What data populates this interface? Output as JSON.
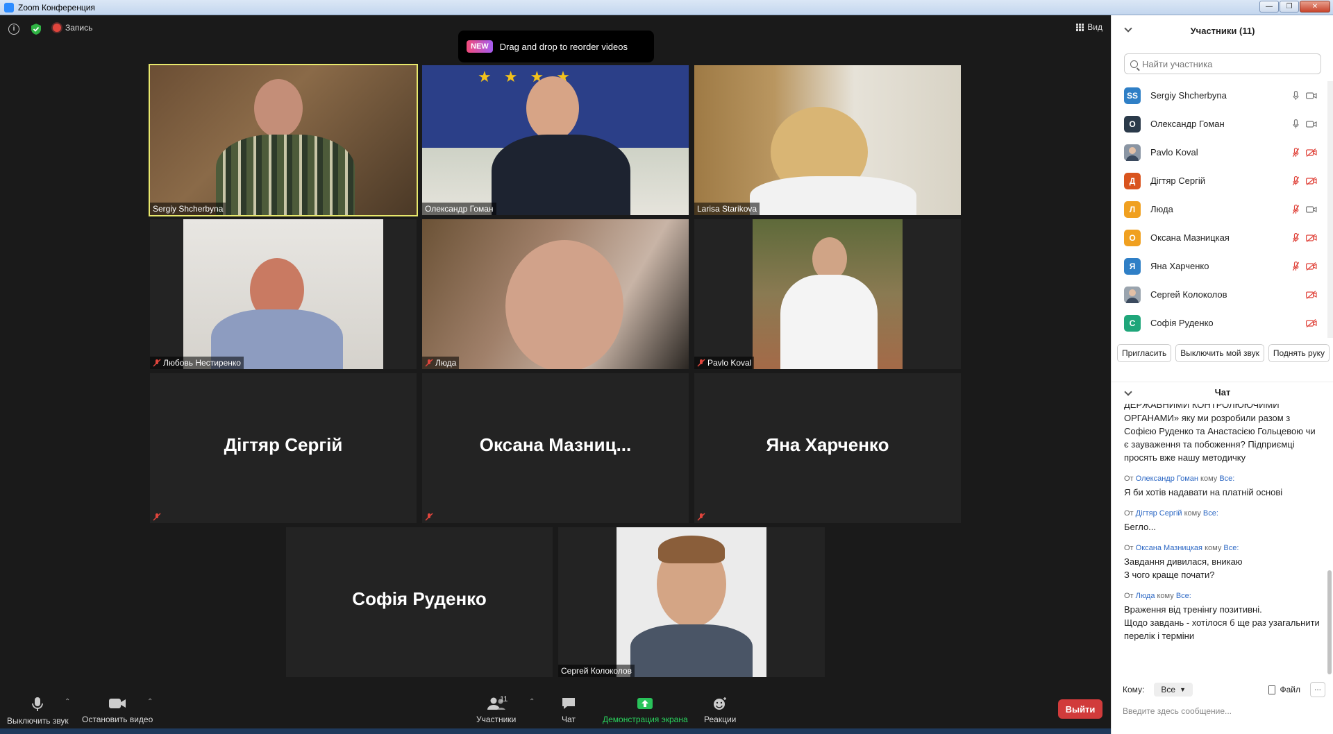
{
  "window": {
    "title": "Zoom Конференция"
  },
  "top_bar": {
    "record_label": "Запись",
    "view_label": "Вид"
  },
  "toast": {
    "badge": "NEW",
    "text": "Drag and drop to reorder videos"
  },
  "tiles": [
    {
      "name": "Sergiy Shcherbyna",
      "muted": false,
      "active": true
    },
    {
      "name": "Олександр Гоман",
      "muted": false
    },
    {
      "name": "Larisa Starikova",
      "muted": false
    },
    {
      "name": "Любовь Нестиренко",
      "muted": true
    },
    {
      "name": "Люда",
      "muted": true
    },
    {
      "name": "Pavlo Koval",
      "muted": true
    },
    {
      "name": "Дігтяр Сергій",
      "muted": true
    },
    {
      "name": "Оксана  Мазниц...",
      "muted": true
    },
    {
      "name": "Яна Харченко",
      "muted": true
    },
    {
      "name": "Софія Руденко",
      "muted": false
    },
    {
      "name": "Сергей Колоколов",
      "muted": false
    }
  ],
  "toolbar": {
    "mute_label": "Выключить звук",
    "video_label": "Остановить видео",
    "participants_label": "Участники",
    "participants_count": "11",
    "chat_label": "Чат",
    "share_label": "Демонстрация экрана",
    "reactions_label": "Реакции",
    "leave_label": "Выйти"
  },
  "panel": {
    "participants_title": "Участники (11)",
    "search_placeholder": "Найти участника",
    "participants": [
      {
        "initials": "SS",
        "name": "Sergiy Shcherbyna",
        "color": "#2f7fc6",
        "mic": "on",
        "cam": "on"
      },
      {
        "initials": "О",
        "name": "Олександр Гоман",
        "color": "#2b3a4a",
        "mic": "on",
        "cam": "on"
      },
      {
        "initials": "",
        "name": "Pavlo Koval",
        "color": "#8a95a3",
        "mic": "off",
        "cam": "off"
      },
      {
        "initials": "Д",
        "name": "Дігтяр Сергій",
        "color": "#d9541e",
        "mic": "off",
        "cam": "off"
      },
      {
        "initials": "Л",
        "name": "Люда",
        "color": "#f0a020",
        "mic": "off",
        "cam": "on"
      },
      {
        "initials": "О",
        "name": "Оксана Мазницкая",
        "color": "#f0a020",
        "mic": "off",
        "cam": "off"
      },
      {
        "initials": "Я",
        "name": "Яна Харченко",
        "color": "#2f7fc6",
        "mic": "off",
        "cam": "off"
      },
      {
        "initials": "",
        "name": "Сергей Колоколов",
        "color": "#9aa4ae",
        "mic": "none",
        "cam": "off"
      },
      {
        "initials": "С",
        "name": "Софія Руденко",
        "color": "#1fa67a",
        "mic": "none",
        "cam": "off"
      }
    ],
    "invite_label": "Пригласить",
    "mute_me_label": "Выключить мой звук",
    "raise_hand_label": "Поднять руку",
    "chat_title": "Чат",
    "chat_first": "ДЕРЖАВНИМИ КОНТРОЛЮЮЧИМИ ОРГАНАМИ»  яку ми розробили разом з Софією Руденко та Анастасією Гольцевою чи є зауваження та побоження?  Підприємці просять вже нашу методичку",
    "messages": [
      {
        "from_prefix": "От",
        "from": "Олександр Гоман",
        "to_prefix": "кому",
        "to": "Все:",
        "text": "Я би хотів надавати на платній основі"
      },
      {
        "from_prefix": "От",
        "from": "Дігтяр Сергій",
        "to_prefix": "кому",
        "to": "Все:",
        "text": "Бегло..."
      },
      {
        "from_prefix": "От",
        "from": "Оксана Мазницкая",
        "to_prefix": "кому",
        "to": "Все:",
        "text": "Завдання дивилася, вникаю\nЗ чого краще почати?"
      },
      {
        "from_prefix": "От",
        "from": "Люда",
        "to_prefix": "кому",
        "to": "Все:",
        "text": "Враження від тренінгу позитивні.\nЩодо завдань - хотілося б ще раз узагальнити перелік і терміни"
      }
    ],
    "to_label": "Кому:",
    "to_value": "Все",
    "file_label": "Файл",
    "more_label": "...",
    "message_placeholder": "Введите здесь сообщение..."
  }
}
